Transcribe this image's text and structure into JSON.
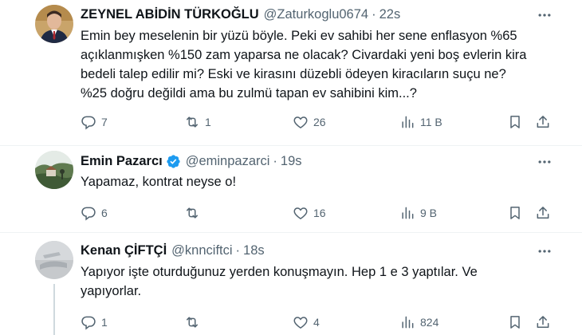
{
  "tweets": [
    {
      "author_name": "ZEYNEL ABİDİN TÜRKOĞLU",
      "handle": "@Zaturkoglu0674",
      "separator": "·",
      "time": "22s",
      "verified": false,
      "text_lines": [
        "Emin bey meselenin bir yüzü böyle. Peki ev sahibi her sene enflasyon %65",
        "açıklanmışken %150 zam yaparsa ne olacak? Civardaki yeni boş evlerin kira",
        "bedeli talep edilir mi? Eski ve kirasını düzebli ödeyen kiracıların suçu ne?",
        "%25 doğru değildi ama bu zulmü tapan ev sahibini kim...?"
      ],
      "replies": "7",
      "retweets": "1",
      "likes": "26",
      "views": "11 B",
      "avatar_icon": "profile-photo-man-suit"
    },
    {
      "author_name": "Emin Pazarcı",
      "handle": "@eminpazarci",
      "separator": "·",
      "time": "19s",
      "verified": true,
      "text_lines": [
        "Yapamaz, kontrat neyse o!"
      ],
      "replies": "6",
      "retweets": "",
      "likes": "16",
      "views": "9 B",
      "avatar_icon": "profile-photo-landscape"
    },
    {
      "author_name": "Kenan ÇİFTÇİ",
      "handle": "@knnciftci",
      "separator": "·",
      "time": "18s",
      "verified": false,
      "text_lines": [
        "Yapıyor işte oturduğunuz yerden konuşmayın. Hep 1 e 3 yaptılar. Ve",
        "yapıyorlar."
      ],
      "replies": "1",
      "retweets": "",
      "likes": "4",
      "views": "824",
      "avatar_icon": "profile-photo-grey"
    }
  ],
  "colors": {
    "text": "#0f1419",
    "secondary": "#536471",
    "verified_blue": "#1d9bf0",
    "border": "#eff3f4",
    "thread_line": "#cfd9de"
  }
}
